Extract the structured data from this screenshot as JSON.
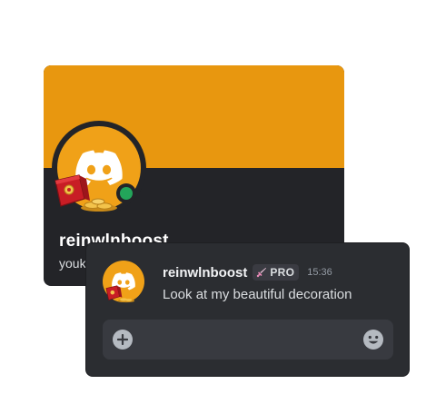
{
  "colors": {
    "banner": "#e8970f",
    "avatar_bg": "#f0a118",
    "online": "#23a55a",
    "card_bg": "#232428",
    "panel_bg": "#2b2d31",
    "input_bg": "#383a40"
  },
  "profile": {
    "display_name": "reinwlnboost",
    "handle": "youk",
    "avatar_icon": "discord-logo-icon",
    "status": "online",
    "decoration_icon": "red-gift-box-icon"
  },
  "message": {
    "username": "reinwlnboost",
    "badge_icon": "sword-icon",
    "badge_label": "PRO",
    "timestamp": "15:36",
    "text": "Look at my beautiful decoration"
  },
  "composer": {
    "add_icon": "plus-circle-icon",
    "emoji_icon": "smiley-icon"
  }
}
